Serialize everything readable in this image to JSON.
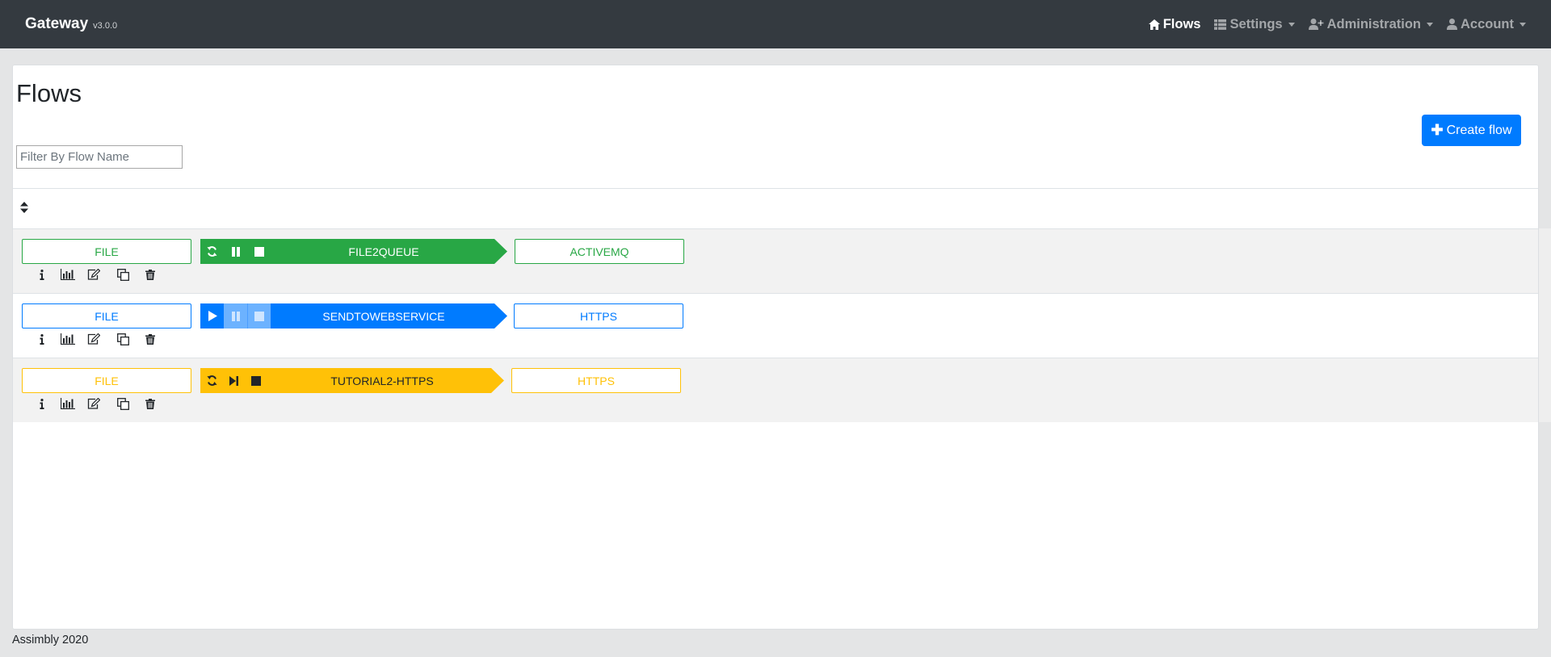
{
  "navbar": {
    "brand": "Gateway",
    "version": "v3.0.0",
    "items": [
      {
        "label": "Flows",
        "icon": "home-icon",
        "active": true
      },
      {
        "label": "Settings",
        "icon": "table-icon",
        "dropdown": true
      },
      {
        "label": "Administration",
        "icon": "user-plus-icon",
        "dropdown": true
      },
      {
        "label": "Account",
        "icon": "user-icon",
        "dropdown": true
      }
    ]
  },
  "page": {
    "title": "Flows",
    "create_button": "Create flow",
    "filter_placeholder": "Filter By Flow Name"
  },
  "flows": [
    {
      "source": "FILE",
      "name": "FILE2QUEUE",
      "target": "ACTIVEMQ",
      "status": "started",
      "color": "#28a745"
    },
    {
      "source": "FILE",
      "name": "SENDTOWEBSERVICE",
      "target": "HTTPS",
      "status": "stopped",
      "color": "#007bff"
    },
    {
      "source": "FILE",
      "name": "TUTORIAL2-HTTPS",
      "target": "HTTPS",
      "status": "paused",
      "color": "#ffc107"
    }
  ],
  "footer": "Assimbly 2020",
  "colors": {
    "navbar": "#343a40",
    "primary": "#007bff",
    "success": "#28a745",
    "warning": "#ffc107"
  }
}
